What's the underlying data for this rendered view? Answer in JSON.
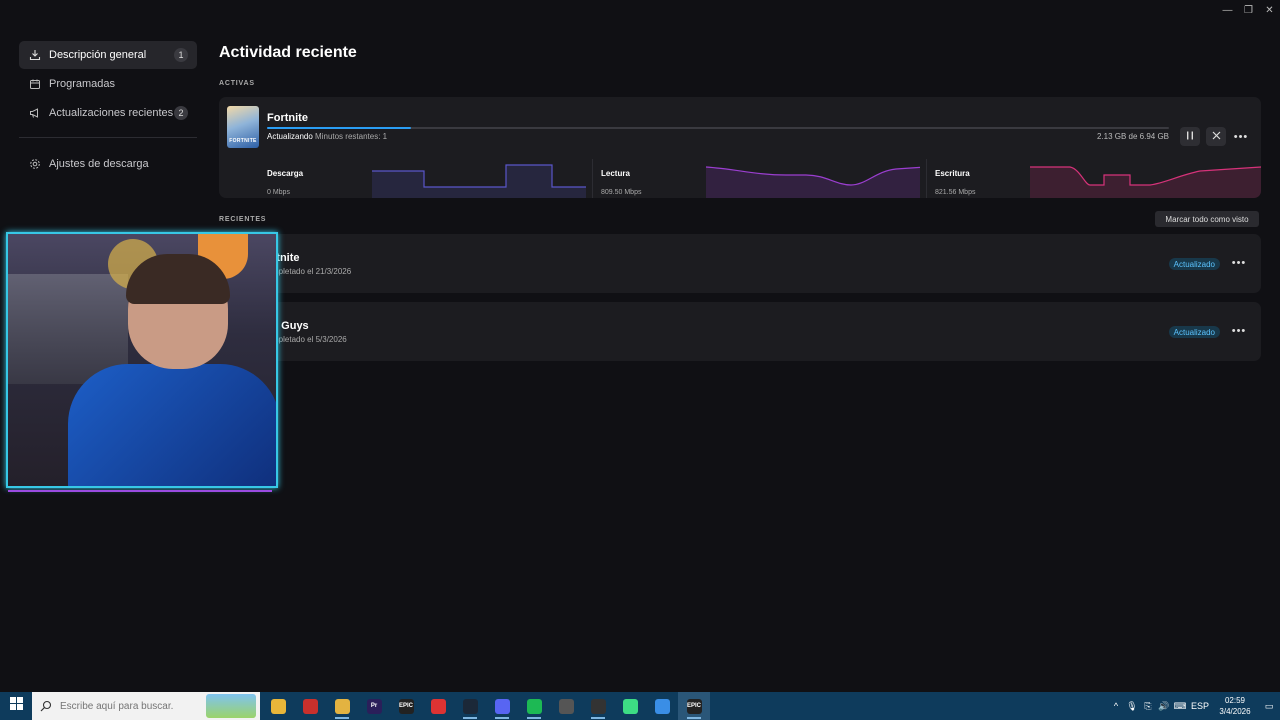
{
  "window_controls": {
    "minimize": "—",
    "restore": "❐",
    "close": "✕"
  },
  "sidebar": {
    "items": [
      {
        "label": "Descripción general",
        "count": "1",
        "icon": "download-icon"
      },
      {
        "label": "Programadas",
        "count": "",
        "icon": "calendar-icon"
      },
      {
        "label": "Actualizaciones recientes",
        "count": "2",
        "icon": "megaphone-icon"
      },
      {
        "label": "Ajustes de descarga",
        "count": "",
        "icon": "gear-icon"
      }
    ]
  },
  "main": {
    "title": "Actividad reciente",
    "active_label": "ACTIVAS",
    "recent_label": "RECIENTES",
    "mark_all_label": "Marcar todo como visto"
  },
  "active_download": {
    "thumb_label": "FORTNITE",
    "name": "Fortnite",
    "progress": 0.16,
    "status": "Actualizando",
    "remaining": "Minutos restantes: 1",
    "size": "2.13 GB de 6.94 GB",
    "pause_icon": "pause-icon",
    "cancel_icon": "close-icon",
    "stats": [
      {
        "label": "Descarga",
        "value": "0 Mbps",
        "color": "#5a56c9"
      },
      {
        "label": "Lectura",
        "value": "809.50 Mbps",
        "color": "#9b3fd0"
      },
      {
        "label": "Escritura",
        "value": "821.56 Mbps",
        "color": "#d6337a"
      }
    ]
  },
  "recent": [
    {
      "name": "rtnite",
      "sub": "mpletado el 21/3/2026",
      "badge": "Actualizado"
    },
    {
      "name": "ll Guys",
      "sub": "mpletado el 5/3/2026",
      "badge": "Actualizado"
    }
  ],
  "taskbar": {
    "search_placeholder": "Escribe aquí para buscar.",
    "apps": [
      {
        "name": "file-explorer-icon",
        "label": "",
        "color": "#e8b63a"
      },
      {
        "name": "app-red-icon",
        "label": "",
        "color": "#c9302c"
      },
      {
        "name": "chrome-icon",
        "label": "",
        "color": "#e3b341"
      },
      {
        "name": "premiere-icon",
        "label": "Pr",
        "color": "#2a1f5a"
      },
      {
        "name": "epic-games-icon",
        "label": "EPIC",
        "color": "#222"
      },
      {
        "name": "app-red2-icon",
        "label": "",
        "color": "#d33"
      },
      {
        "name": "steam-icon",
        "label": "",
        "color": "#1b2838"
      },
      {
        "name": "discord-icon",
        "label": "",
        "color": "#5865f2"
      },
      {
        "name": "spotify-icon",
        "label": "",
        "color": "#1db954"
      },
      {
        "name": "app-gray-icon",
        "label": "",
        "color": "#555"
      },
      {
        "name": "obs-icon",
        "label": "",
        "color": "#333"
      },
      {
        "name": "android-icon",
        "label": "",
        "color": "#3ddc84"
      },
      {
        "name": "app-blue-icon",
        "label": "",
        "color": "#3a8ee6"
      },
      {
        "name": "epic-games-active-icon",
        "label": "EPIC",
        "color": "#222"
      }
    ],
    "lang": "ESP",
    "time": "02:59",
    "date": "3/4/2026"
  }
}
